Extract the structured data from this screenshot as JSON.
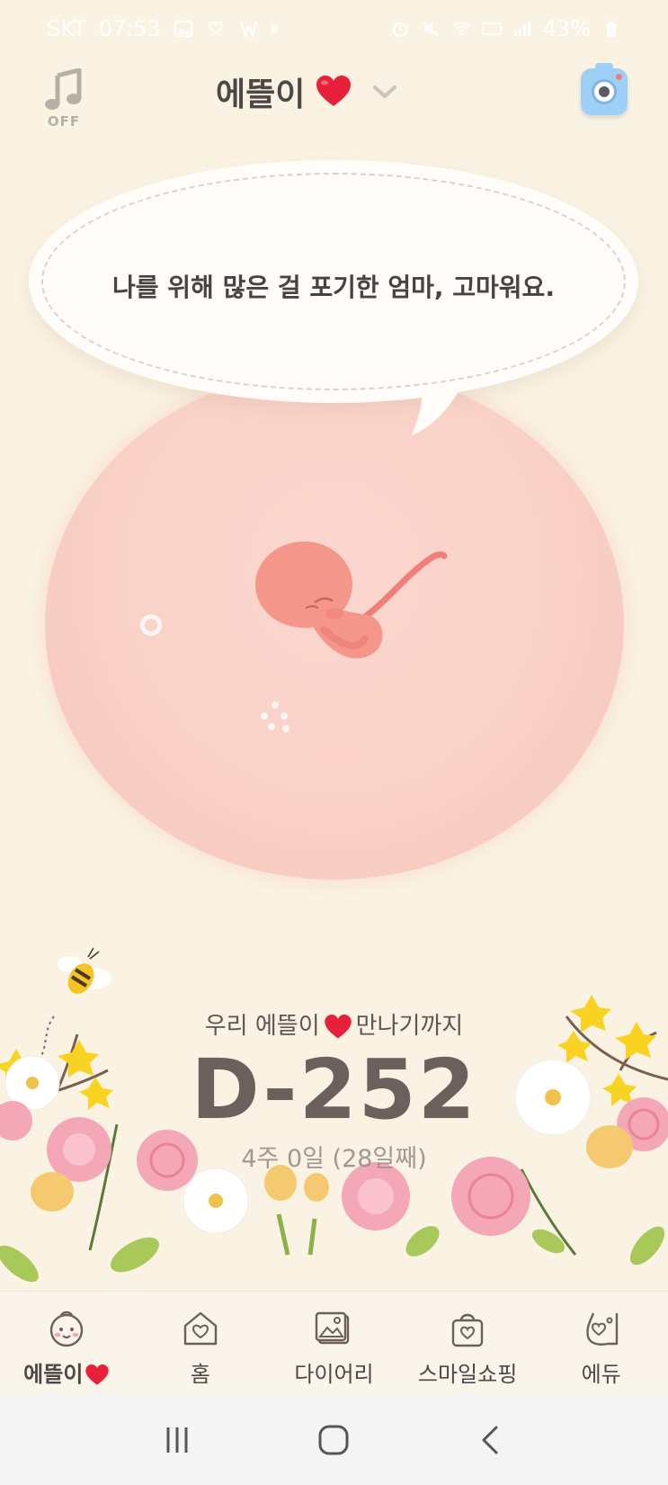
{
  "status_bar": {
    "carrier": "SKT",
    "time": "07:53",
    "battery": "43%"
  },
  "header": {
    "music_toggle_label": "OFF",
    "baby_name": "에뜰이",
    "colors": {
      "heart": "#e8213a",
      "camera": "#9ed0f6"
    }
  },
  "bubble": {
    "message": "나를 위해 많은 걸 포기한 엄마, 고마워요."
  },
  "countdown": {
    "prefix": "우리 에뜰이",
    "suffix": "만나기까지",
    "dday": "D-252",
    "week_info": "4주 0일 (28일째)"
  },
  "tabs": [
    {
      "label": "에뜰이",
      "icon": "baby-face-icon",
      "active": true
    },
    {
      "label": "홈",
      "icon": "home-heart-icon",
      "active": false
    },
    {
      "label": "다이어리",
      "icon": "photo-diary-icon",
      "active": false
    },
    {
      "label": "스마일쇼핑",
      "icon": "shopping-bag-icon",
      "active": false
    },
    {
      "label": "에듀",
      "icon": "pregnant-belly-icon",
      "active": false
    }
  ],
  "nav": [
    "recent-apps-icon",
    "home-icon",
    "back-icon"
  ]
}
